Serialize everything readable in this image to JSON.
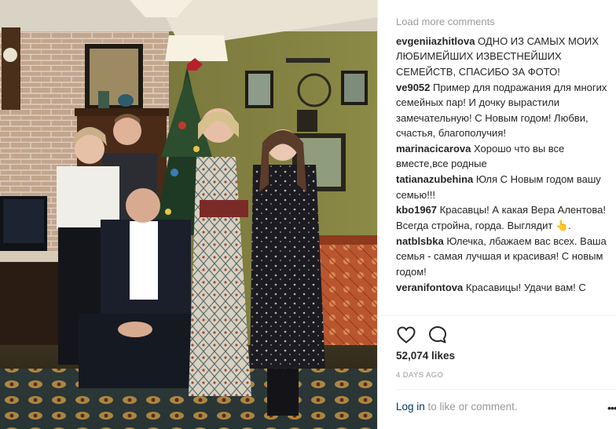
{
  "post": {
    "photo_alt": "",
    "load_more": "Load more comments",
    "comments": [
      {
        "user": "evgeniiazhitlova",
        "text": "ОДНО ИЗ САМЫХ МОИХ ЛЮБИМЕЙШИХ ИЗВЕСТНЕЙШИХ СЕМЕЙСТВ, СПАСИБО ЗА ФОТО!"
      },
      {
        "user": "ve9052",
        "text": "Пример для подражания для многих семейных пар! И дочку вырастили замечательную! С Новым годом! Любви, счастья, благополучия!"
      },
      {
        "user": "marinacicarova",
        "text": "Хорошо что вы все вместе,все родные"
      },
      {
        "user": "tatianazubehina",
        "text": "Юля С Новым годом вашу семью!!!"
      },
      {
        "user": "kbo1967",
        "text": "Красавцы! А какая Вера Алентова! Всегда стройна, горда. Выглядит 👆."
      },
      {
        "user": "natblsbka",
        "text": "Юлечка, лбажаем вас всех. Ваша семья - самая лучшая и красивая! С новым годом!"
      },
      {
        "user": "veranifontova",
        "text": "Красавицы! Удачи вам! С"
      }
    ],
    "likes": "52,074 likes",
    "time_ago": "4 DAYS AGO",
    "login_link": "Log in",
    "login_suffix": " to like or comment.",
    "more_glyph": "•••"
  },
  "icons": {
    "like": "heart-icon",
    "comment": "comment-bubble-icon",
    "more": "more-options-icon"
  },
  "colors": {
    "link_blue": "#003569",
    "accent_blue": "#3897f0",
    "muted_gray": "#999999",
    "text": "#262626"
  }
}
